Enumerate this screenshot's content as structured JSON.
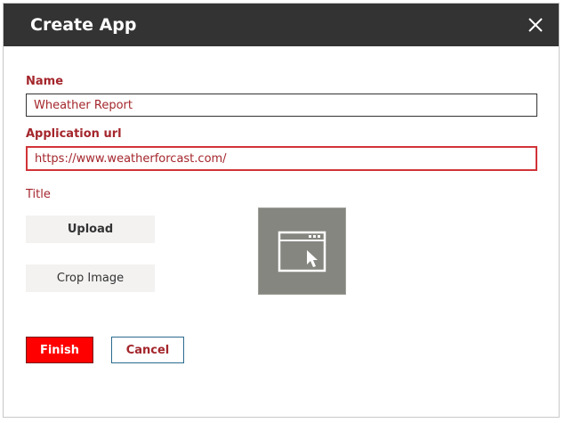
{
  "dialog": {
    "title": "Create App",
    "close_icon": "close-icon"
  },
  "form": {
    "name_label": "Name",
    "name_value": "Wheather Report",
    "url_label": "Application url",
    "url_value": "https://www.weatherforcast.com/",
    "title_label": "Title"
  },
  "image": {
    "upload_label": "Upload",
    "crop_label": "Crop Image",
    "preview_icon": "browser-window-cursor-icon"
  },
  "actions": {
    "finish_label": "Finish",
    "cancel_label": "Cancel"
  },
  "colors": {
    "titlebar": "#333333",
    "label": "#a4262c",
    "finish": "#ff0000",
    "preview_bg": "#868680"
  }
}
